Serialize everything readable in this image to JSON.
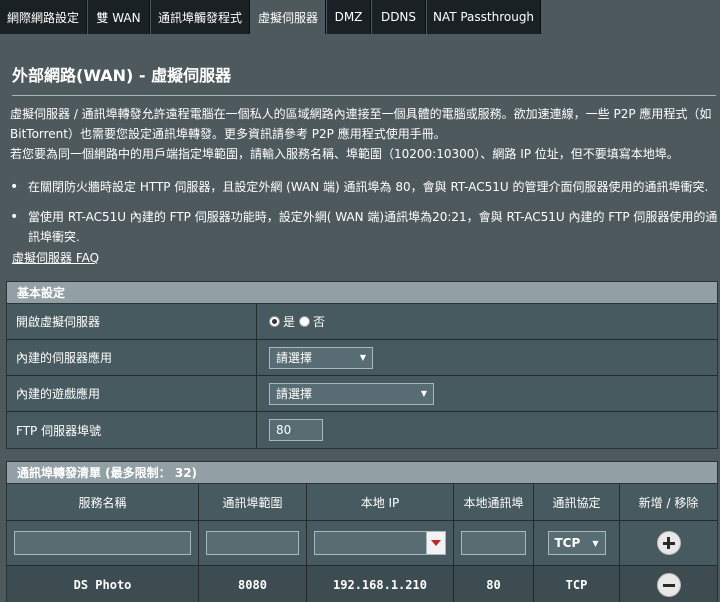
{
  "tabs": [
    {
      "label": "網際網路設定"
    },
    {
      "label": "雙 WAN"
    },
    {
      "label": "通訊埠觸發程式"
    },
    {
      "label": "虛擬伺服器"
    },
    {
      "label": "DMZ"
    },
    {
      "label": "DDNS"
    },
    {
      "label": "NAT Passthrough"
    }
  ],
  "page": {
    "title": "外部網路(WAN) - 虛擬伺服器",
    "desc1": "虛擬伺服器 / 通訊埠轉發允許遠程電腦在一個私人的區域網路內連接至一個具體的電腦或服務。欲加速連線，一些 P2P 應用程式（如 BitTorrent）也需要您設定通訊埠轉發。更多資訊請參考 P2P 應用程式使用手冊。",
    "desc2": "若您要為同一個網路中的用戶端指定埠範圍，請輸入服務名稱、埠範圍（10200:10300）、網路 IP 位址，但不要填寫本地埠。",
    "bullet1": "在關閉防火牆時設定 HTTP 伺服器，且設定外網 (WAN 端) 通訊埠為 80，會與 RT-AC51U 的管理介面伺服器使用的通訊埠衝突.",
    "bullet2": "當使用 RT-AC51U 內建的 FTP 伺服器功能時，設定外網( WAN 端)通訊埠為20:21，會與 RT-AC51U 內建的 FTP 伺服器使用的通訊埠衝突.",
    "faq": "虛擬伺服器 FAQ"
  },
  "basic": {
    "header": "基本設定",
    "enable_label": "開啟虛擬伺服器",
    "yes": "是",
    "no": "否",
    "server_app_label": "內建的伺服器應用",
    "server_app_value": "請選擇",
    "game_app_label": "內建的遊戲應用",
    "game_app_value": "請選擇",
    "ftp_port_label": "FTP 伺服器埠號",
    "ftp_port_value": "80"
  },
  "list": {
    "header": "通訊埠轉發清單 (最多限制： 32)",
    "columns": [
      "服務名稱",
      "通訊埠範圍",
      "本地 IP",
      "本地通訊埠",
      "通訊協定",
      "新增 / 移除"
    ],
    "protocol_default": "TCP",
    "rows": [
      {
        "service": "DS Photo",
        "port_range": "8080",
        "local_ip": "192.168.1.210",
        "local_port": "80",
        "protocol": "TCP"
      }
    ]
  }
}
